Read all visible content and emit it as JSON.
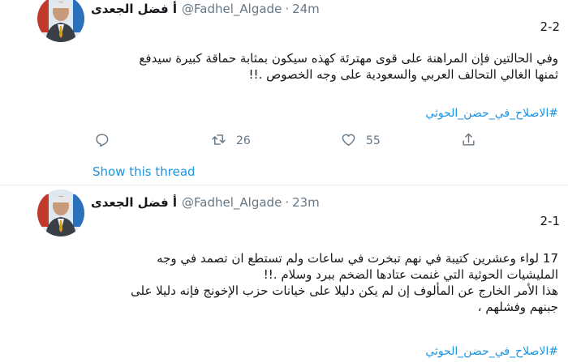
{
  "tweets": [
    {
      "display_name": "أ فضل الجعدى",
      "handle": "@Fadhel_Algade",
      "separator": "·",
      "time": "24m",
      "thread_count": "2-2",
      "text_lines": [
        "وفي الحالتين فإن المراهنة على قوى مهترئة كهذه سيكون بمثابة حماقة كبيرة سيدفع",
        "ثمنها الغالي التحالف العربي والسعودية على وجه الخصوص .!!"
      ],
      "hashtag": "#الاصلاح_في_حضن_الحوثي",
      "retweets": "26",
      "likes": "55",
      "show_thread": "Show this thread"
    },
    {
      "display_name": "أ فضل الجعدى",
      "handle": "@Fadhel_Algade",
      "separator": "·",
      "time": "23m",
      "thread_count": "2-1",
      "text_lines": [
        "17 لواء وعشرين كتيبة في نهم تبخرت في ساعات ولم تستطع ان تصمد في وجه",
        "المليشيات الحوثية التي غنمت عتادها الضخم ببرد وسلام .!!",
        "هذا الأمر الخارج عن المألوف إن لم يكن دليلا على خيانات حزب الإخونج فإنه دليلا على",
        "جبنهم وفشلهم ،"
      ],
      "hashtag": "#الاصلاح_في_حضن_الحوثي"
    }
  ],
  "icons": {
    "reply": "reply-icon",
    "retweet": "retweet-icon",
    "like": "heart-icon",
    "share": "share-icon"
  },
  "colors": {
    "link": "#1b95e0",
    "secondary_text": "#657786",
    "divider": "#e6ecf0"
  }
}
